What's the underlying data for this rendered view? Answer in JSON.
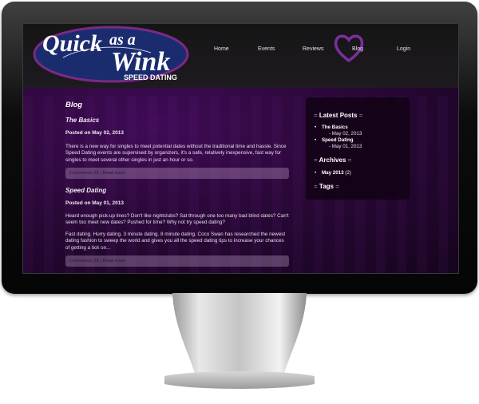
{
  "logo": {
    "line1": "Quick",
    "line2": "as a",
    "line3": "Wink",
    "tagline": "SPEED DATING"
  },
  "nav": {
    "items": [
      {
        "label": "Home"
      },
      {
        "label": "Events"
      },
      {
        "label": "Reviews"
      },
      {
        "label": "Blog",
        "active": true
      },
      {
        "label": "Login"
      }
    ]
  },
  "blog": {
    "title": "Blog",
    "posts": [
      {
        "title": "The Basics",
        "date": "Posted on May 02, 2013",
        "paragraphs": [
          "There is a new way for singles to meet potential dates without the traditional time and hassle. Since Speed Dating events are supervised by organizers, it's a safe, relatively inexpensive, fast way for singles to meet several other singles in just an hour or so."
        ],
        "meta": "Comments (0) | Read more"
      },
      {
        "title": "Speed Dating",
        "date": "Posted on May 01, 2013",
        "paragraphs": [
          "Heard enough pick-up lines? Don't like nightclubs? Sat through one too many bad blind dates? Can't seem too meet new dates? Pushed for time? Why not try speed dating?",
          "Fast dating. Hurry dating. 3 minute dating. 8 minute dating. Coco Swan has researched the newest dating fashion to sweep the world and gives you all the speed dating tips to increase your chances of getting a tick on..."
        ],
        "meta": "Comments (0) | Read more"
      }
    ]
  },
  "sidebar": {
    "latest_heading": "Latest Posts",
    "latest": [
      {
        "title": "The Basics",
        "date": "- May 02, 2013"
      },
      {
        "title": "Speed Dating",
        "date": "- May 01, 2013"
      }
    ],
    "archives_heading": "Archives",
    "archives": [
      {
        "label": "May 2013",
        "count": "(2)"
      }
    ],
    "tags_heading": "Tags",
    "heading_marker": "="
  },
  "colors": {
    "accent": "#8a2aa8",
    "heart": "#7b2ea0",
    "logo_bg": "#1b2c6e"
  }
}
